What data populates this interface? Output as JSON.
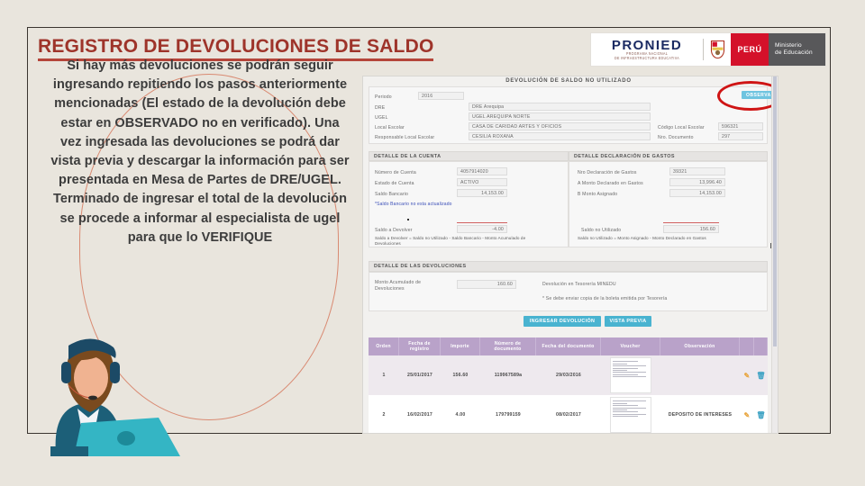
{
  "slide": {
    "title": "REGISTRO DE DEVOLUCIONES DE SALDO",
    "title_color": "#9e342a",
    "background_color": "#e9e5dd",
    "callout_text": "Si hay más devoluciones se podrán seguir ingresando repitiendo los pasos anteriormente mencionadas (El estado de la devolución debe estar en OBSERVADO no en verificado). Una vez ingresada las devoluciones se podrá dar vista previa y descargar la información para ser presentada en Mesa de Partes de DRE/UGEL.\nTerminado de ingresar  el total de la devolución se procede a informar al especialista de ugel para que lo VERIFIQUE"
  },
  "logo": {
    "brand": "PRONIED",
    "brand_color": "#1b2b63",
    "sub_line1": "PROGRAMA NACIONAL",
    "sub_line2": "DE INFRAESTRUCTURA EDUCATIVA",
    "peru_label": "PERÚ",
    "peru_color": "#d4112a",
    "ministry_line1": "Ministerio",
    "ministry_line2": "de Educación"
  },
  "app": {
    "header_title": "DEVOLUCIÓN DE SALDO NO UTILIZADO",
    "status_badge": "OBSERVADO",
    "status_badge_color": "#6fc4e0",
    "highlight_circle_color": "#cf1414",
    "identification": {
      "periodo_label": "Periodo",
      "periodo_value": "2016",
      "dre_label": "DRE",
      "dre_value": "DRE Arequipa",
      "ugel_label": "UGEL",
      "ugel_value": "UGEL AREQUIPA NORTE",
      "local_escolar_label": "Local Escolar",
      "local_escolar_value": "CASA DE CARIDAD ARTES Y OFICIOS",
      "codigo_local_label": "Código Local Escolar",
      "codigo_local_value": "596321",
      "responsable_label": "Responsable Local Escolar",
      "responsable_value": "CESILIA ROXANA",
      "nro_documento_label": "Nro. Documento",
      "nro_documento_value": "297"
    },
    "detalle_cuenta": {
      "section_title": "DETALLE DE LA CUENTA",
      "numero_cuenta_label": "Número de Cuenta",
      "numero_cuenta_value": "4057914020",
      "estado_cuenta_label": "Estado de Cuenta",
      "estado_cuenta_value": "ACTIVO",
      "saldo_bancario_label": "Saldo Bancario",
      "saldo_bancario_value": "14,153.00",
      "note": "*Saldo Bancario no esta actualizado",
      "saldo_devolver_label": "Saldo a Devolver",
      "saldo_devolver_value": "-4.00",
      "formula": "Saldo a Devolver = Saldo no Utilizado - Saldo Bancario - Monto Acumulado de Devoluciones"
    },
    "detalle_gastos": {
      "section_title": "DETALLE DECLARACIÓN DE GASTOS",
      "nro_declaracion_label": "Nro Declaración de Gastos",
      "nro_declaracion_value": "39321",
      "monto_declarado_label": "A  Monto Declarado en Gastos",
      "monto_declarado_value": "13,996.40",
      "monto_asignado_label": "B  Monto Asignado",
      "monto_asignado_value": "14,153.00",
      "saldo_no_utilizado_label": "Saldo no Utilizado",
      "saldo_no_utilizado_value": "156.60",
      "formula": "Saldo no Utilizado = Monto Asignado - Monto Declarado en Gastos"
    },
    "detalle_devoluciones": {
      "section_title": "DETALLE DE LAS DEVOLUCIONES",
      "monto_acumulado_label": "Monto Acumulado de Devoluciones",
      "monto_acumulado_value": "160.60",
      "tesoreria_text": "Devolución en Tesorería MINEDU",
      "tesoreria_note": "* Se debe enviar copia de la boleta emitida por Tesorería",
      "btn_ingresar": "INGRESAR DEVOLUCIÓN",
      "btn_vista_previa": "VISTA PREVIA",
      "btn_color": "#49b3d0"
    },
    "table": {
      "headers": [
        "Orden",
        "Fecha de registro",
        "Importe",
        "Número de documento",
        "Fecha del documento",
        "Voucher",
        "Observación",
        "",
        ""
      ],
      "header_color": "#b9a2c9",
      "rows": [
        {
          "orden": "1",
          "fecha_registro": "25/01/2017",
          "importe": "156.60",
          "numero_documento": "119967589a",
          "fecha_documento": "29/03/2016",
          "observacion": "",
          "edit_icon": "pencil-icon",
          "delete_icon": "trash-icon"
        },
        {
          "orden": "2",
          "fecha_registro": "16/02/2017",
          "importe": "4.00",
          "numero_documento": "179799159",
          "fecha_documento": "08/02/2017",
          "observacion": "DEPOSITO DE INTERESES",
          "edit_icon": "pencil-icon",
          "delete_icon": "trash-icon"
        }
      ]
    }
  }
}
